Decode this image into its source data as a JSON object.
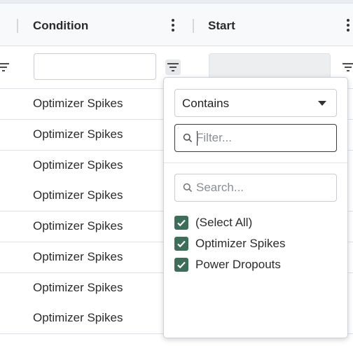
{
  "columns": [
    {
      "title": "Condition"
    },
    {
      "title": "Start"
    }
  ],
  "rows": [
    "Optimizer Spikes",
    "Optimizer Spikes",
    "Optimizer Spikes",
    "Optimizer Spikes",
    "Optimizer Spikes",
    "Optimizer Spikes",
    "Optimizer Spikes",
    "Optimizer Spikes"
  ],
  "filter_popup": {
    "operator": "Contains",
    "filter_placeholder": "Filter...",
    "search_placeholder": "Search...",
    "options": [
      {
        "label": "(Select All)",
        "checked": true
      },
      {
        "label": "Optimizer Spikes",
        "checked": true
      },
      {
        "label": "Power Dropouts",
        "checked": true
      }
    ]
  },
  "colors": {
    "accent_checkbox": "#3d6e5a",
    "header_bg": "#f8f9fa",
    "border": "#dde1e6"
  }
}
